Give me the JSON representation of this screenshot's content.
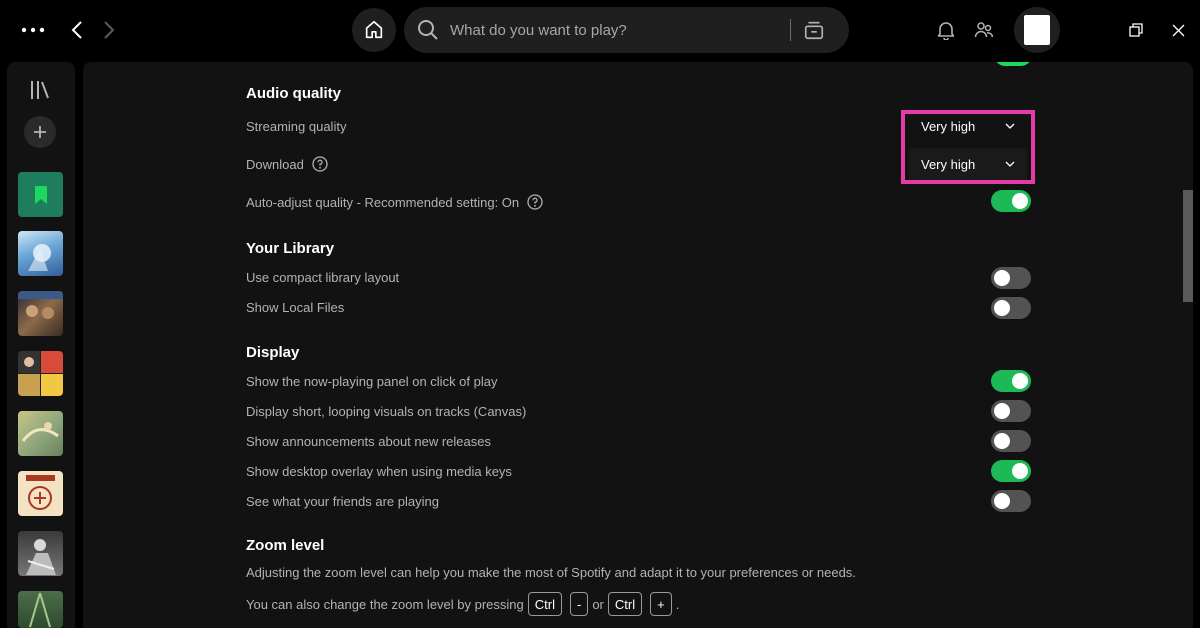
{
  "topbar": {
    "search_placeholder": "What do you want to play?",
    "more_icon": "more-dots-icon",
    "home_icon": "home-icon",
    "search_icon": "search-icon",
    "browse_icon": "browse-icon",
    "bell_icon": "bell-icon",
    "friends_icon": "friends-icon"
  },
  "sidebar": {
    "library_icon": "library-icon",
    "add_icon": "plus-icon"
  },
  "settings": {
    "audio_quality": {
      "title": "Audio quality",
      "streaming_label": "Streaming quality",
      "streaming_value": "Very high",
      "download_label": "Download",
      "download_value": "Very high",
      "auto_adjust_label": "Auto-adjust quality - Recommended setting: On",
      "auto_adjust_on": true
    },
    "library": {
      "title": "Your Library",
      "items": [
        {
          "label": "Use compact library layout",
          "on": false
        },
        {
          "label": "Show Local Files",
          "on": false
        }
      ]
    },
    "display": {
      "title": "Display",
      "items": [
        {
          "label": "Show the now-playing panel on click of play",
          "on": true
        },
        {
          "label": "Display short, looping visuals on tracks (Canvas)",
          "on": false
        },
        {
          "label": "Show announcements about new releases",
          "on": false
        },
        {
          "label": "Show desktop overlay when using media keys",
          "on": true
        },
        {
          "label": "See what your friends are playing",
          "on": false
        }
      ]
    },
    "zoom": {
      "title": "Zoom level",
      "desc1": "Adjusting the zoom level can help you make the most of Spotify and adapt it to your preferences or needs.",
      "desc2_prefix": "You can also change the zoom level by pressing",
      "key_ctrl": "Ctrl",
      "key_minus": "-",
      "or": "or",
      "key_plus": "+",
      "end": "."
    }
  },
  "colors": {
    "accent": "#1db954",
    "highlight": "#e53ba8"
  }
}
